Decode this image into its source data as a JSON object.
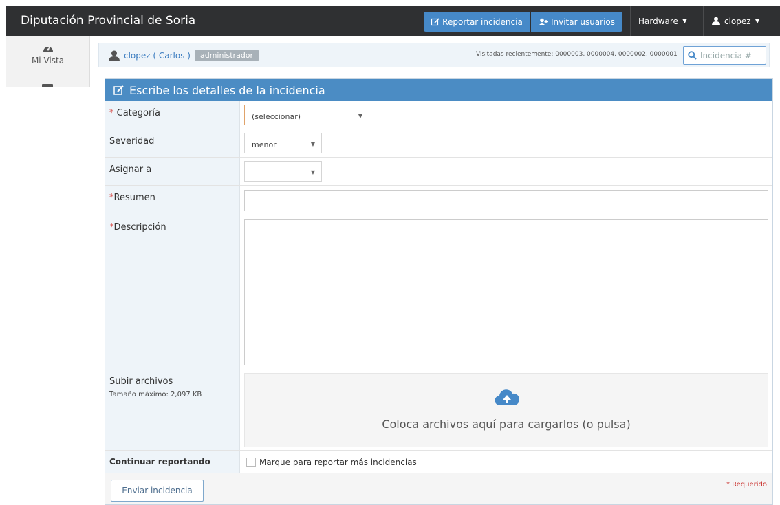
{
  "navbar": {
    "brand": "Diputación Provincial de Soria",
    "report_label": "Reportar incidencia",
    "invite_label": "Invitar usuarios",
    "project_label": "Hardware",
    "user_label": "clopez"
  },
  "sidebar": {
    "items": [
      {
        "label": "Mi Vista",
        "icon": "dashboard-icon"
      }
    ]
  },
  "breadcrumb": {
    "user_link": "clopez ( Carlos )",
    "role_badge": "administrador",
    "recent_text": "Visitadas recientemente: 0000003, 0000004, 0000002, 0000001",
    "search_placeholder": "Incidencia #"
  },
  "form": {
    "header": "Escribe los detalles de la incidencia",
    "category_label": "Categoría",
    "category_value": "(seleccionar)",
    "severity_label": "Severidad",
    "severity_value": "menor",
    "assign_label": "Asignar a",
    "assign_value": "",
    "summary_label": "Resumen",
    "description_label": "Descripción",
    "upload_label": "Subir archivos",
    "upload_max": "Tamaño máximo: 2,097 KB",
    "dropzone_text": "Coloca archivos aquí para cargarlos (o pulsa)",
    "continue_label": "Continuar reportando",
    "continue_checkbox_label": "Marque para reportar más incidencias",
    "submit_label": "Enviar incidencia",
    "required_note": "* Requerido",
    "required_mark": "*"
  },
  "colors": {
    "navbar": "#2f3032",
    "accent": "#4689c8",
    "header": "#4b8cc4",
    "required": "#d9534f",
    "category_focus_border": "#e0a36a"
  }
}
